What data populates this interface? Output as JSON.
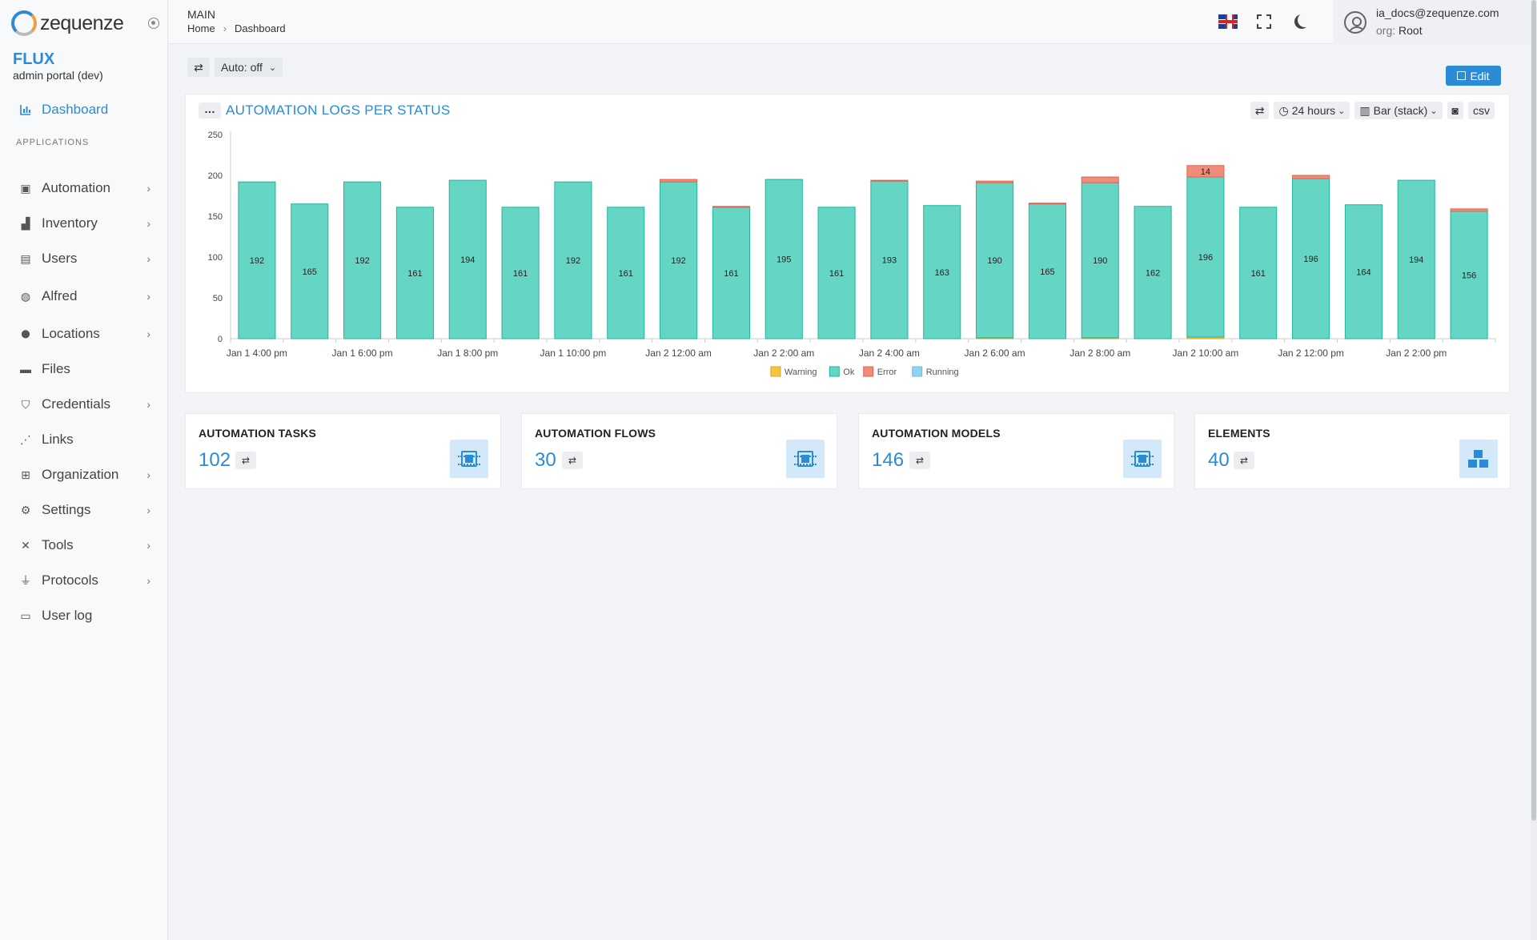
{
  "app": {
    "logo_text": "zequenze",
    "brand_title": "FLUX",
    "brand_subtitle": "admin portal (dev)"
  },
  "sidebar": {
    "dashboard_label": "Dashboard",
    "section_label": "APPLICATIONS",
    "items": [
      {
        "label": "Automation",
        "icon": "chip-icon",
        "has_children": true
      },
      {
        "label": "Inventory",
        "icon": "boxes-icon",
        "has_children": true
      },
      {
        "label": "Users",
        "icon": "id-card-icon",
        "has_children": true
      },
      {
        "label": "Alfred",
        "icon": "robot-icon",
        "has_children": true
      },
      {
        "label": "Locations",
        "icon": "map-pin-icon",
        "has_children": true
      },
      {
        "label": "Files",
        "icon": "folder-icon",
        "has_children": false
      },
      {
        "label": "Credentials",
        "icon": "shield-icon",
        "has_children": true
      },
      {
        "label": "Links",
        "icon": "share-icon",
        "has_children": false
      },
      {
        "label": "Organization",
        "icon": "sitemap-icon",
        "has_children": true
      },
      {
        "label": "Settings",
        "icon": "cogs-icon",
        "has_children": true
      },
      {
        "label": "Tools",
        "icon": "tools-icon",
        "has_children": true
      },
      {
        "label": "Protocols",
        "icon": "plug-icon",
        "has_children": true
      },
      {
        "label": "User log",
        "icon": "calendar-icon",
        "has_children": false
      }
    ]
  },
  "header": {
    "section": "MAIN",
    "breadcrumb": [
      "Home",
      "Dashboard"
    ],
    "user_email": "ia_docs@zequenze.com",
    "org_label": "org:",
    "org_value": "Root"
  },
  "toolbar": {
    "auto_label": "Auto: off",
    "edit_label": "Edit"
  },
  "panel": {
    "title": "AUTOMATION LOGS PER STATUS",
    "range_label": "24 hours",
    "chart_type_label": "Bar (stack)",
    "csv_label": "csv"
  },
  "chart_data": {
    "type": "bar",
    "stacked": true,
    "categories": [
      "Jan 1 4:00 pm",
      "Jan 1 5:00 pm",
      "Jan 1 6:00 pm",
      "Jan 1 7:00 pm",
      "Jan 1 8:00 pm",
      "Jan 1 9:00 pm",
      "Jan 1 10:00 pm",
      "Jan 1 11:00 pm",
      "Jan 2 12:00 am",
      "Jan 2 1:00 am",
      "Jan 2 2:00 am",
      "Jan 2 3:00 am",
      "Jan 2 4:00 am",
      "Jan 2 5:00 am",
      "Jan 2 6:00 am",
      "Jan 2 7:00 am",
      "Jan 2 8:00 am",
      "Jan 2 9:00 am",
      "Jan 2 10:00 am",
      "Jan 2 11:00 am",
      "Jan 2 12:00 pm",
      "Jan 2 1:00 pm",
      "Jan 2 2:00 pm",
      "Jan 2 3:00 pm"
    ],
    "xtick_labels": [
      "Jan 1 4:00 pm",
      "Jan 1 6:00 pm",
      "Jan 1 8:00 pm",
      "Jan 1 10:00 pm",
      "Jan 2 12:00 am",
      "Jan 2 2:00 am",
      "Jan 2 4:00 am",
      "Jan 2 6:00 am",
      "Jan 2 8:00 am",
      "Jan 2 10:00 am",
      "Jan 2 12:00 pm",
      "Jan 2 2:00 pm"
    ],
    "series": [
      {
        "name": "Warning",
        "color": "#f5c542",
        "values": [
          0,
          0,
          0,
          0,
          0,
          0,
          0,
          0,
          0,
          0,
          0,
          0,
          0,
          0,
          1,
          0,
          1,
          0,
          2,
          0,
          0,
          0,
          0,
          0
        ]
      },
      {
        "name": "Ok",
        "color": "#66d6c4",
        "values": [
          192,
          165,
          192,
          161,
          194,
          161,
          192,
          161,
          192,
          161,
          195,
          161,
          193,
          163,
          190,
          165,
          190,
          162,
          196,
          161,
          196,
          164,
          194,
          156
        ]
      },
      {
        "name": "Error",
        "color": "#f08d7a",
        "values": [
          0,
          0,
          0,
          0,
          0,
          0,
          0,
          0,
          3,
          1,
          0,
          0,
          1,
          0,
          2,
          1,
          7,
          0,
          14,
          0,
          4,
          0,
          0,
          3
        ]
      },
      {
        "name": "Running",
        "color": "#8fd3f0",
        "values": [
          0,
          0,
          0,
          0,
          0,
          0,
          0,
          0,
          0,
          0,
          0,
          0,
          0,
          0,
          0,
          0,
          0,
          0,
          0,
          0,
          0,
          0,
          0,
          0
        ]
      }
    ],
    "data_labels_series": "Ok",
    "extra_label": {
      "index": 18,
      "series": "Error",
      "text": "14"
    },
    "ylim": [
      0,
      250
    ],
    "yticks": [
      0,
      50,
      100,
      150,
      200,
      250
    ],
    "xlabel": "",
    "ylabel": "",
    "legend_position": "bottom-center",
    "grid": false
  },
  "cards": [
    {
      "title": "AUTOMATION TASKS",
      "value": "102",
      "icon": "chip-icon"
    },
    {
      "title": "AUTOMATION FLOWS",
      "value": "30",
      "icon": "chip-icon"
    },
    {
      "title": "AUTOMATION MODELS",
      "value": "146",
      "icon": "chip-icon"
    },
    {
      "title": "ELEMENTS",
      "value": "40",
      "icon": "boxes-icon"
    }
  ]
}
